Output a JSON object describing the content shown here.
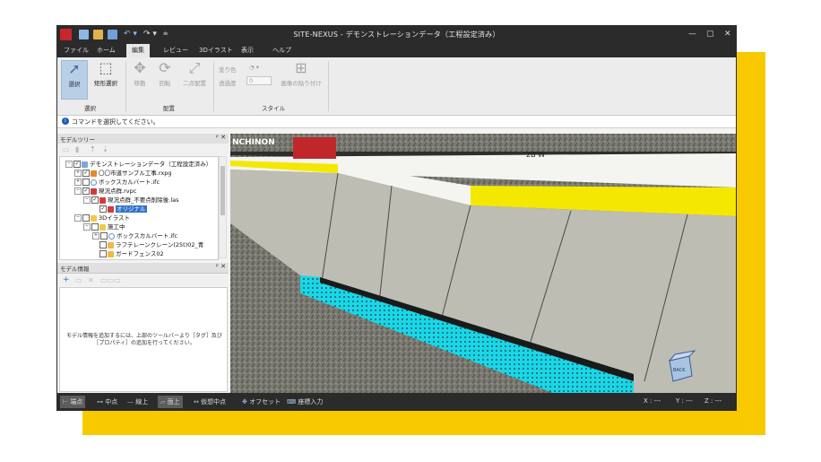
{
  "window": {
    "title": "SITE-NEXUS - デモンストレーションデータ（工程設定済み）"
  },
  "menu": {
    "tabs": [
      "ファイル",
      "ホーム",
      "編集",
      "レビュー",
      "3Dイラスト",
      "表示",
      "ヘルプ"
    ],
    "active": "編集"
  },
  "ribbon": {
    "select_group": {
      "label": "選択",
      "select": "選択",
      "rect_select": "矩形選択"
    },
    "place_group": {
      "label": "配置",
      "move": "移動",
      "rotate": "回転",
      "two_point": "二点配置"
    },
    "style_group": {
      "label": "スタイル",
      "fill_color": "塗り色",
      "transparency": "透過度",
      "transparency_value": "0",
      "paste_image": "画像の貼り付け"
    }
  },
  "command_bar": {
    "message": "コマンドを選択してください。"
  },
  "model_tree": {
    "title": "モデルツリー",
    "pin": "ᵖ ✕",
    "nodes": [
      {
        "label": "デモンストレーションデータ（工程設定済み）",
        "exp": "−"
      },
      {
        "label": "〇〇市道サンプル工事.rxpg",
        "exp": "+"
      },
      {
        "label": "ボックスカルバート.ifc",
        "exp": "+"
      },
      {
        "label": "現況点群.rvpc",
        "exp": "−"
      },
      {
        "label": "現況点群_不要点削除後.las",
        "exp": "−"
      },
      {
        "label": "オリジナル",
        "exp": ""
      },
      {
        "label": "3Dイラスト",
        "exp": "−"
      },
      {
        "label": "施工中",
        "exp": "−"
      },
      {
        "label": "ボックスカルバート.ifc",
        "exp": "+"
      },
      {
        "label": "ラフテレーンクレーン(25t)02_青",
        "exp": ""
      },
      {
        "label": "ガードフェンス02",
        "exp": ""
      }
    ]
  },
  "model_info": {
    "title": "モデル情報",
    "pin": "ᵖ ✕",
    "message_line1": "モデル情報を追加するには、上部のツールバーより［タグ］及び",
    "message_line2": "［プロパティ］の追加を行ってください。"
  },
  "viewport": {
    "sign_text": "NCHINON",
    "overlay_text": "2B W",
    "navcube_label": "BACK"
  },
  "status_bar": {
    "snaps": [
      "端点",
      "中点",
      "線上",
      "面上",
      "仮想中点",
      "オフセット",
      "座標入力"
    ],
    "coords": {
      "x": "X : ---",
      "y": "Y : ---",
      "z": "Z : ---"
    }
  },
  "colors": {
    "accent": "#3074c9",
    "titlebar": "#2b2b2b",
    "highlight_yellow": "#f9c900"
  }
}
